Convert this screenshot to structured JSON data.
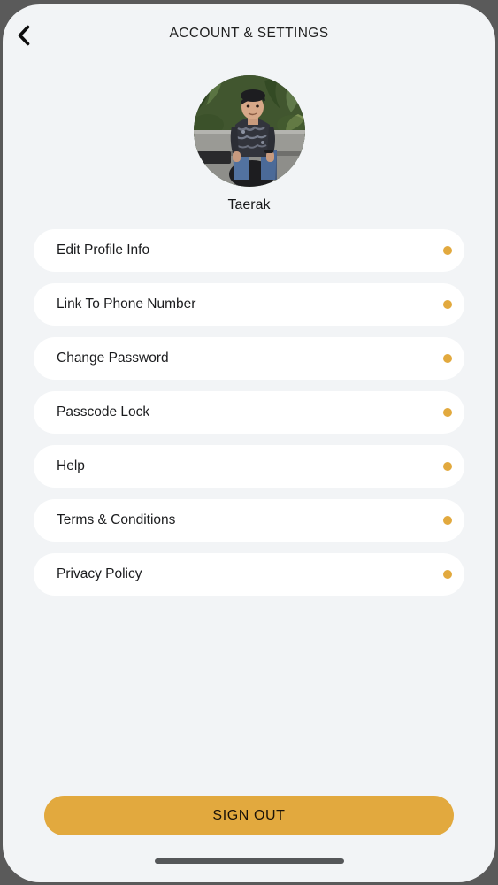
{
  "theme": {
    "background": "#f2f4f6",
    "card": "#ffffff",
    "accent": "#e2a93e",
    "text": "#1a1b1d",
    "frame": "#5a5a5a",
    "home_indicator": "#555759"
  },
  "header": {
    "title": "ACCOUNT & SETTINGS",
    "back_icon": "chevron-left-icon"
  },
  "profile": {
    "name": "Taerak",
    "avatar_alt": "Person in dark camouflage shirt and cap sitting in front of tropical plants"
  },
  "settings": {
    "items": [
      {
        "label": "Edit Profile Info",
        "dot": "status-dot"
      },
      {
        "label": "Link To Phone Number",
        "dot": "status-dot"
      },
      {
        "label": "Change Password",
        "dot": "status-dot"
      },
      {
        "label": "Passcode Lock",
        "dot": "status-dot"
      },
      {
        "label": "Help",
        "dot": "status-dot"
      },
      {
        "label": "Terms & Conditions",
        "dot": "status-dot"
      },
      {
        "label": "Privacy Policy",
        "dot": "status-dot"
      }
    ]
  },
  "footer": {
    "sign_out_label": "SIGN OUT"
  }
}
